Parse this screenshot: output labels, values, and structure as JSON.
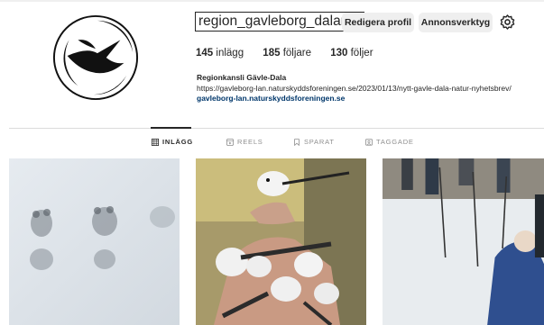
{
  "profile": {
    "username": "region_gavleborg_dalarna",
    "edit_label": "Redigera profil",
    "ads_label": "Annonsverktyg",
    "avatar_icon": "bird-logo-icon",
    "settings_icon": "gear-icon"
  },
  "stats": {
    "posts_count": "145",
    "posts_label": "inlägg",
    "followers_count": "185",
    "followers_label": "följare",
    "following_count": "130",
    "following_label": "följer"
  },
  "bio": {
    "name": "Regionkansli Gävle-Dala",
    "url_text": "https://gavleborg-lan.naturskyddsforeningen.se/2023/01/13/nytt-gavle-dala-natur-nyhetsbrev/",
    "website": "gavleborg-lan.naturskyddsforeningen.se"
  },
  "tabs": [
    {
      "label": "INLÄGG",
      "icon": "grid-icon",
      "active": true
    },
    {
      "label": "REELS",
      "icon": "reels-icon",
      "active": false
    },
    {
      "label": "SPARAT",
      "icon": "bookmark-icon",
      "active": false
    },
    {
      "label": "TAGGADE",
      "icon": "tag-icon",
      "active": false
    }
  ],
  "posts": [
    {
      "subject": "animal tracks in snow"
    },
    {
      "subject": "long-tailed tits held in hand"
    },
    {
      "subject": "people with ski poles in snowy forest"
    }
  ],
  "colors": {
    "button_bg": "#efefef",
    "link": "#00376b",
    "muted": "#8e8e8e",
    "divider": "#dbdbdb"
  }
}
